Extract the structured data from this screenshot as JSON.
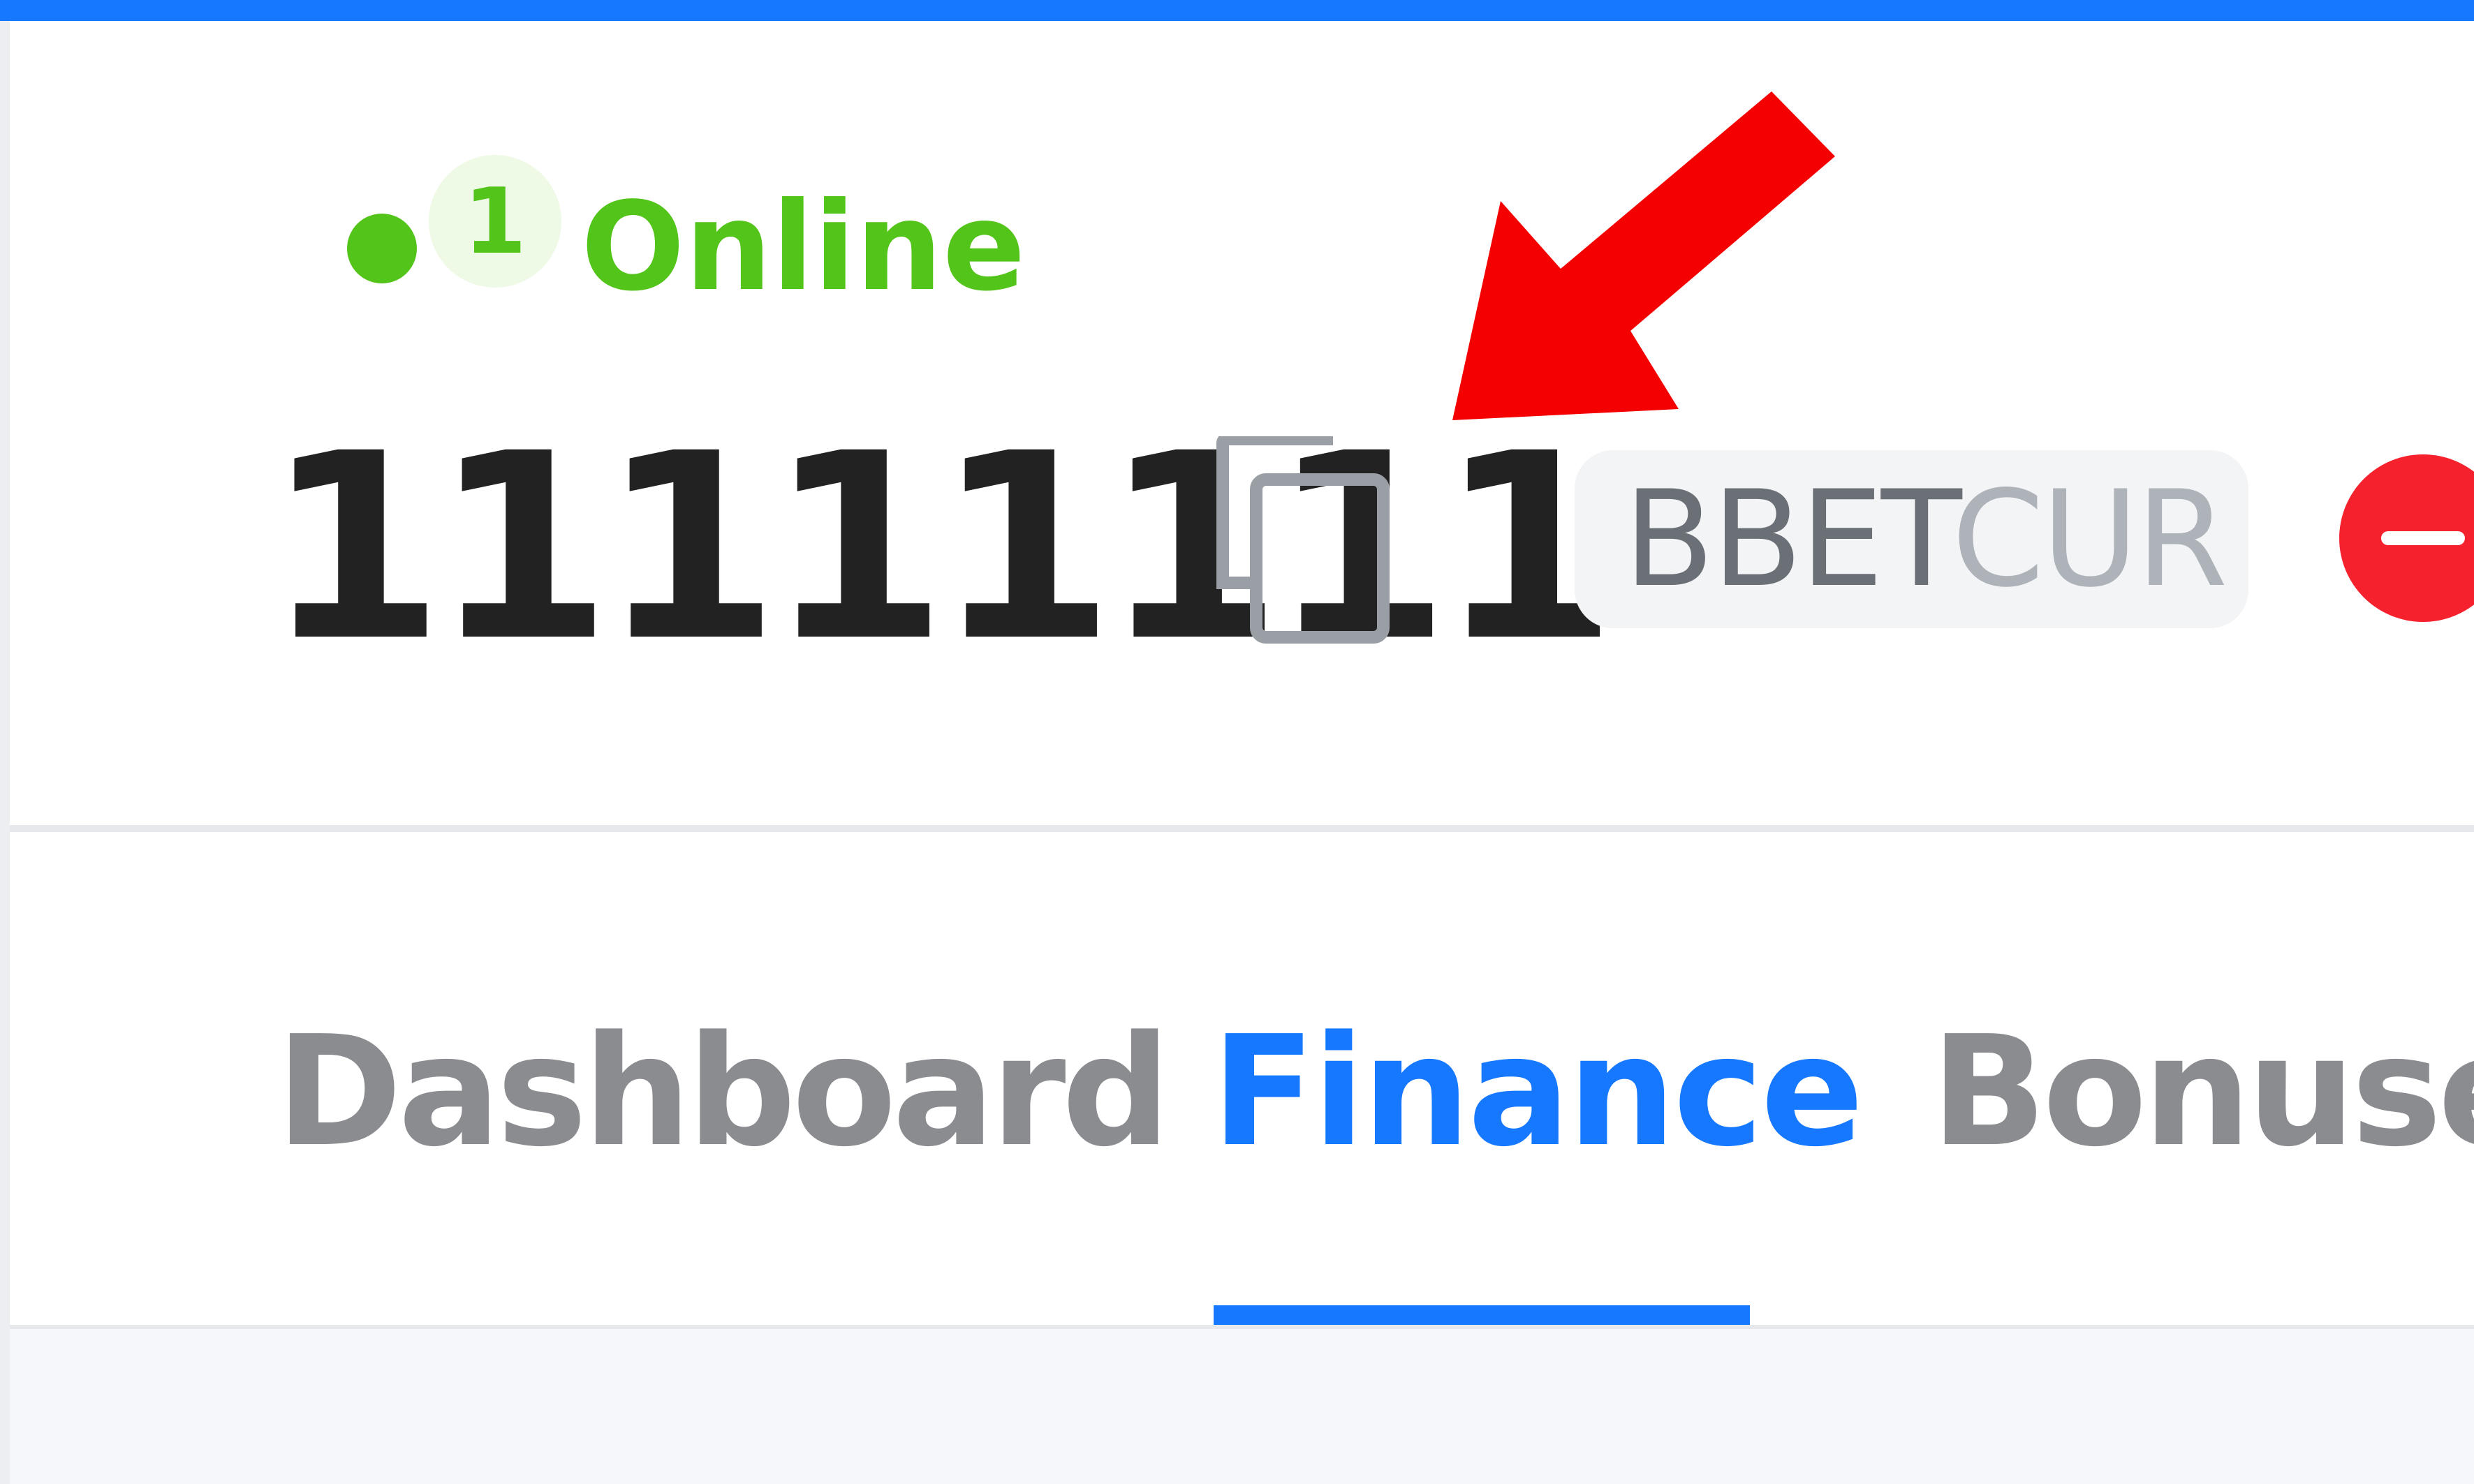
{
  "status": {
    "count": "1",
    "label": "Online",
    "color": "#52c41a"
  },
  "user": {
    "id": "11111111"
  },
  "currency_tag": {
    "main": "BBET",
    "sub": "CUR"
  },
  "icons": {
    "copy": "copy-icon",
    "remove": "minus-circle-icon",
    "annotation": "red-arrow-icon"
  },
  "tabs": [
    {
      "label": "Dashboard",
      "active": false
    },
    {
      "label": "Finance",
      "active": true
    },
    {
      "label": "Bonuses",
      "active": false
    }
  ],
  "colors": {
    "accent": "#1677ff",
    "danger": "#f5222d",
    "online": "#52c41a",
    "annotation": "#f50000"
  }
}
